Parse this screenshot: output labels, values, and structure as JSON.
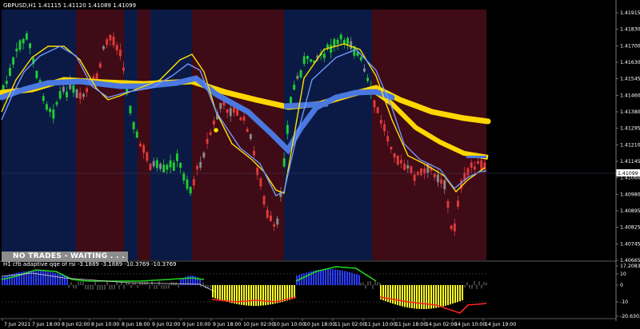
{
  "symbol_header": "GBPUSD,H1  1.41115 1.41120 1.41089 1.41099",
  "current_price": "1.41099",
  "status_banner": "NO TRADES - WAITING . . .",
  "indicator_header": "H1  cfb adaptive qqe of rsi -3.1889 -3.1889 -10.3769 -10.3769",
  "price_axis": [
    "1.41915",
    "1.41830",
    "1.41700",
    "1.41630",
    "1.41545",
    "1.41460",
    "1.41380",
    "1.41295",
    "1.41210",
    "1.41145",
    "1.41060",
    "1.40980",
    "1.40895",
    "1.40825",
    "1.40745",
    "1.40665"
  ],
  "indicator_axis": [
    "17.2083",
    "10",
    "0",
    "-10",
    "-20.6303"
  ],
  "time_axis": [
    "7 Jun 2021",
    "7 Jun 18:00",
    "8 Jun 02:00",
    "8 Jun 10:00",
    "8 Jun 18:00",
    "9 Jun 02:00",
    "9 Jun 10:00",
    "9 Jun 18:00",
    "10 Jun 02:00",
    "10 Jun 10:00",
    "10 Jun 18:00",
    "11 Jun 02:00",
    "11 Jun 10:00",
    "11 Jun 18:00",
    "14 Jun 02:00",
    "14 Jun 10:00",
    "14 Jun 19:00"
  ],
  "colors": {
    "background": "#000000",
    "zone_bull": "#0b1a45",
    "zone_bear": "#3f0b16",
    "candle_up": "#22cc33",
    "candle_down": "#e03a3a",
    "candle_neutral": "#8a8a8a",
    "slow_band": "#ffd700",
    "fast_band": "#4a78e0",
    "signal_line": "#ffe200",
    "rsi_line": "#6f96ff",
    "hist_bull": "#2a3cff",
    "hist_bear": "#ffff22",
    "qqe_green": "#22d822",
    "qqe_red": "#ff2222",
    "banner_bg": "#8c8c8c"
  }
}
